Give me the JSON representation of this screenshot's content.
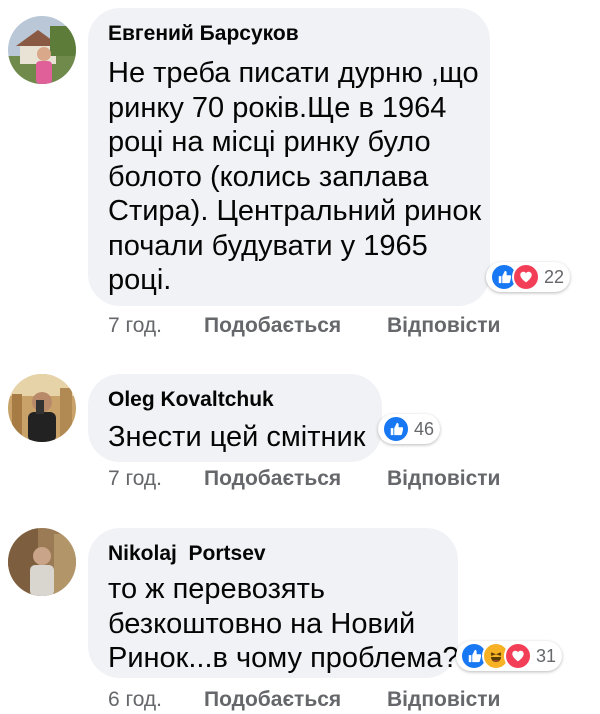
{
  "comments": [
    {
      "author": "Евгений Барсуков",
      "lines": [
        "Не треба писати дурню ,що",
        "ринку 70 років.Ще в 1964",
        "році на місці ринку було",
        "болото (колись заплава",
        "Стира). Центральний ринок",
        "почали будувати у 1965",
        "році."
      ],
      "reactions": [
        "like-icon",
        "love-icon"
      ],
      "reaction_count": "22",
      "time": "7 год.",
      "like_label": "Подобається",
      "reply_label": "Відповісти"
    },
    {
      "author": "Oleg Kovaltchuk",
      "lines": [
        "Знести цей смітник"
      ],
      "reactions": [
        "like-icon"
      ],
      "reaction_count": "46",
      "time": "7 год.",
      "like_label": "Подобається",
      "reply_label": "Відповісти"
    },
    {
      "author": "Nikolaj  Portsev",
      "lines": [
        "то ж перевозять",
        "безкоштовно на Новий",
        "Ринок...в чому проблема?"
      ],
      "reactions": [
        "like-icon",
        "haha-icon",
        "love-icon"
      ],
      "reaction_count": "31",
      "time": "6 год.",
      "like_label": "Подобається",
      "reply_label": "Відповісти"
    }
  ],
  "colors": {
    "bubble": "#f0f2f5",
    "secondary_text": "#65676b",
    "like": "#1877f2",
    "love": "#f33e58",
    "haha": "#f7b125"
  }
}
